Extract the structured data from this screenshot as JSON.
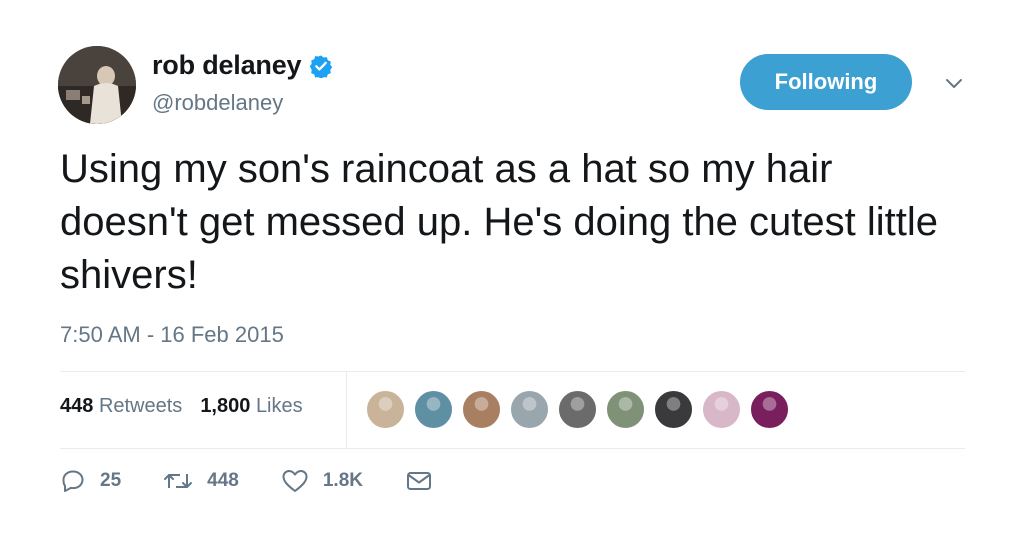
{
  "user": {
    "name": "rob delaney",
    "handle": "@robdelaney",
    "verified_icon": "verified-badge-icon",
    "avatar_icon": "avatar-photo"
  },
  "follow_button": {
    "label": "Following",
    "color": "#3da0d2"
  },
  "menu": {
    "icon": "chevron-down-icon"
  },
  "tweet": {
    "text": "Using my son's raincoat as a hat so my hair doesn't get messed up. He's doing the cutest little shivers!",
    "timestamp": "7:50 AM - 16 Feb 2015"
  },
  "stats": {
    "retweets_count": "448",
    "retweets_label": "Retweets",
    "likes_count": "1,800",
    "likes_label": "Likes",
    "likers": [
      {
        "color": "#c9b49a"
      },
      {
        "color": "#5f8fa3"
      },
      {
        "color": "#a97f62"
      },
      {
        "color": "#9aa6ad"
      },
      {
        "color": "#6b6b6b"
      },
      {
        "color": "#7f9277"
      },
      {
        "color": "#3a3a3d"
      },
      {
        "color": "#d7b7c8"
      },
      {
        "color": "#7a1f5d"
      }
    ]
  },
  "actions": {
    "replies": "25",
    "retweets": "448",
    "likes": "1.8K"
  },
  "colors": {
    "text": "#14171a",
    "secondary": "#657786",
    "divider": "#e6ecf0",
    "brand": "#1da1f2"
  }
}
